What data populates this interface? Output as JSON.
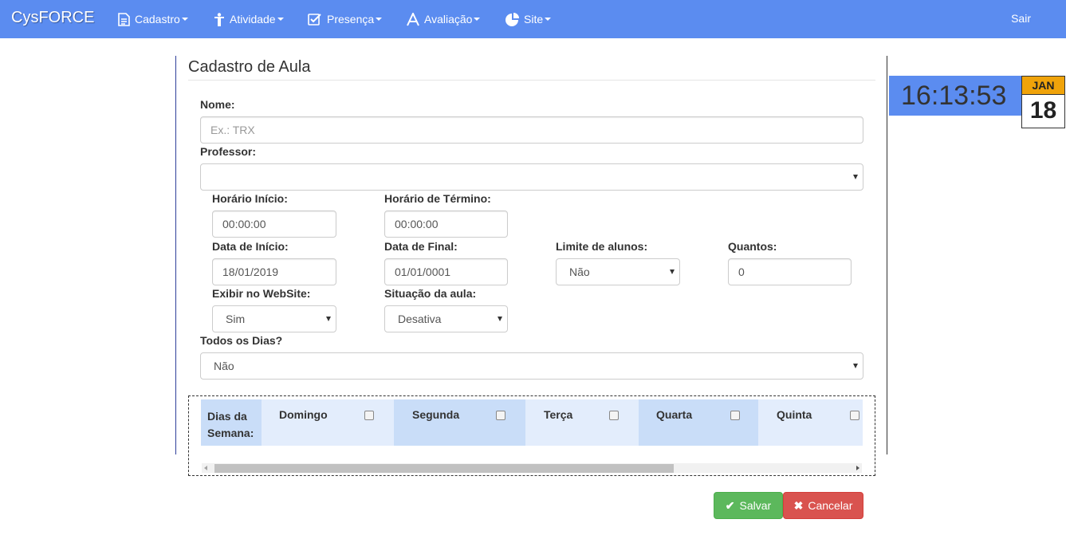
{
  "navbar": {
    "brand": "CysFORCE",
    "items": [
      {
        "label": "Cadastro",
        "icon": "document-icon"
      },
      {
        "label": "Atividade",
        "icon": "person-icon"
      },
      {
        "label": "Presença",
        "icon": "checkbox-icon"
      },
      {
        "label": "Avaliação",
        "icon": "font-icon"
      },
      {
        "label": "Site",
        "icon": "pie-chart-icon"
      }
    ],
    "logout": "Sair",
    "color": "#5b8cf0"
  },
  "page": {
    "title": "Cadastro de Aula"
  },
  "form": {
    "nome": {
      "label": "Nome:",
      "placeholder": "Ex.: TRX",
      "value": ""
    },
    "professor": {
      "label": "Professor:",
      "value": ""
    },
    "horario_inicio": {
      "label": "Horário Início:",
      "value": "00:00:00"
    },
    "horario_termino": {
      "label": "Horário de Término:",
      "value": "00:00:00"
    },
    "data_inicio": {
      "label": "Data de Início:",
      "value": "18/01/2019"
    },
    "data_final": {
      "label": "Data de Final:",
      "value": "01/01/0001"
    },
    "limite_alunos": {
      "label": "Limite de alunos:",
      "value": "Não"
    },
    "quantos": {
      "label": "Quantos:",
      "value": "0"
    },
    "exibir_website": {
      "label": "Exibir no WebSite:",
      "value": "Sim"
    },
    "situacao_aula": {
      "label": "Situação da aula:",
      "value": "Desativa"
    },
    "todos_dias": {
      "label": "Todos os Dias?",
      "value": "Não"
    }
  },
  "days": {
    "header_line1": "Dias da",
    "header_line2": "Semana:",
    "items": [
      {
        "label": "Domingo",
        "checked": false
      },
      {
        "label": "Segunda",
        "checked": false
      },
      {
        "label": "Terça",
        "checked": false
      },
      {
        "label": "Quarta",
        "checked": false
      },
      {
        "label": "Quinta",
        "checked": false
      }
    ]
  },
  "buttons": {
    "save": "Salvar",
    "cancel": "Cancelar",
    "save_color": "#5cb85c",
    "cancel_color": "#d9534f"
  },
  "clock": {
    "time": "16:13:53",
    "month": "JAN",
    "day": "18"
  }
}
